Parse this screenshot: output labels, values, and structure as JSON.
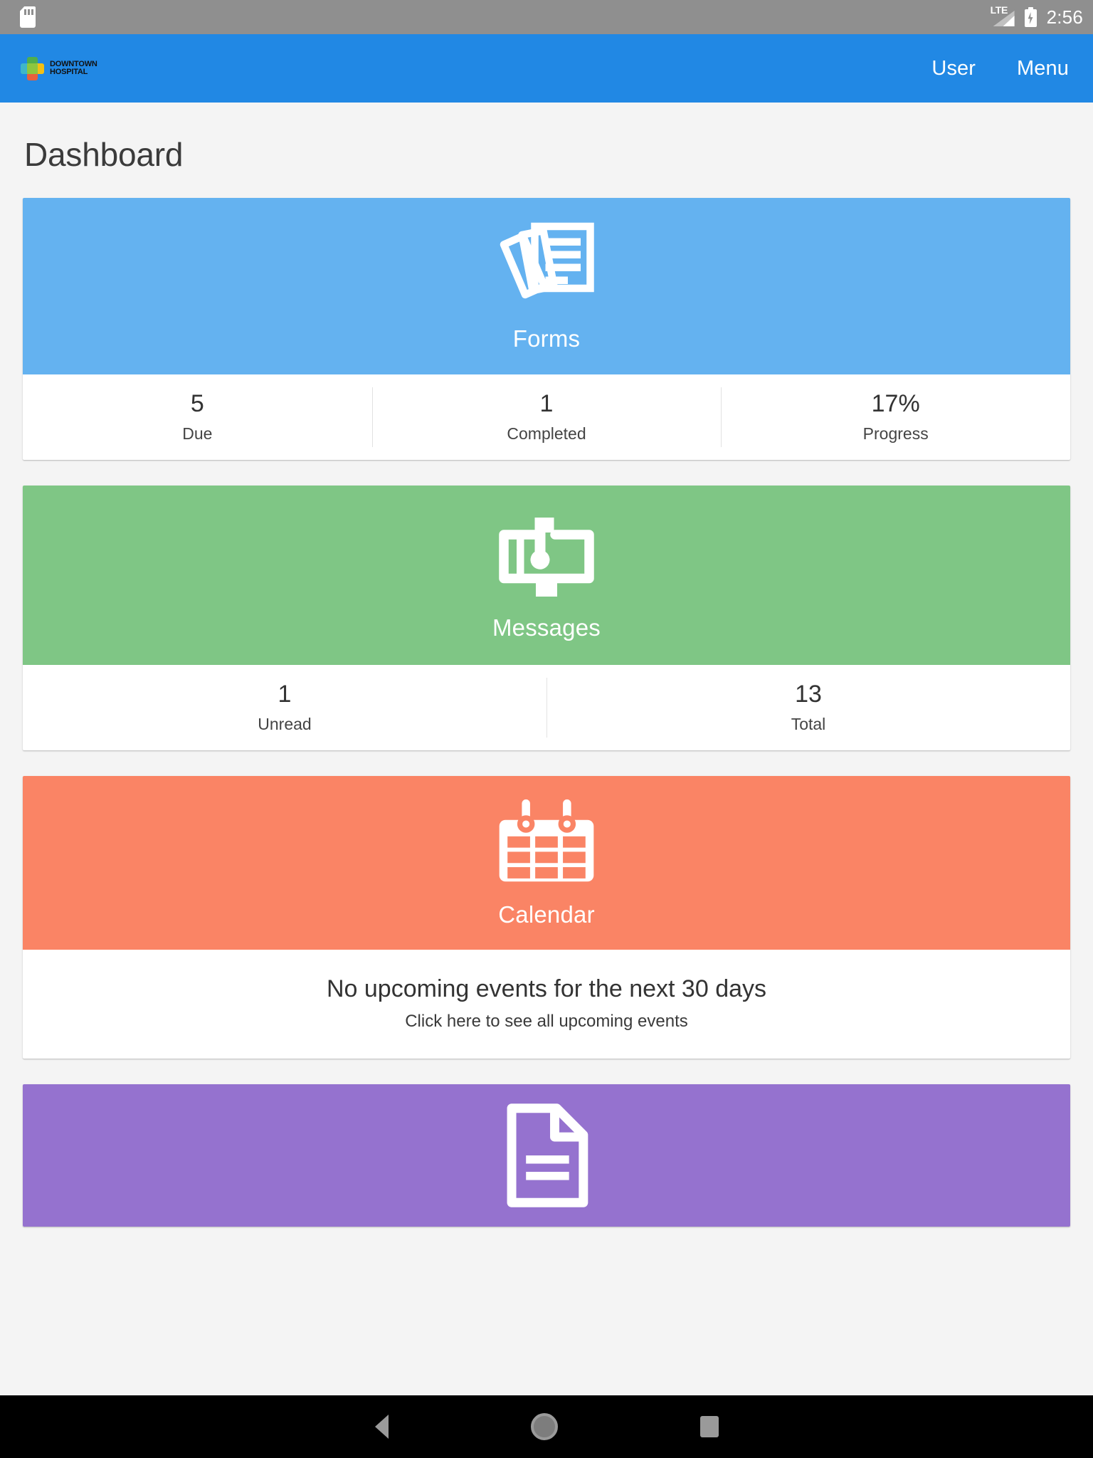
{
  "status_bar": {
    "sd_icon": "sd-card-icon",
    "network": "LTE",
    "battery_state": "charging",
    "time": "2:56"
  },
  "app_bar": {
    "logo_line1": "DOWNTOWN",
    "logo_line2": "HOSPITAL",
    "logo_icon": "pinwheel-cross-logo",
    "nav": [
      {
        "label": "User",
        "name": "user"
      },
      {
        "label": "Menu",
        "name": "menu"
      }
    ]
  },
  "page": {
    "title": "Dashboard"
  },
  "cards": {
    "forms": {
      "label": "Forms",
      "icon": "documents-stack-icon",
      "color": "#64b2f0",
      "stats": [
        {
          "value": "5",
          "label": "Due"
        },
        {
          "value": "1",
          "label": "Completed"
        },
        {
          "value": "17%",
          "label": "Progress"
        }
      ]
    },
    "messages": {
      "label": "Messages",
      "icon": "mailbox-icon",
      "color": "#7fc685",
      "stats": [
        {
          "value": "1",
          "label": "Unread"
        },
        {
          "value": "13",
          "label": "Total"
        }
      ]
    },
    "calendar": {
      "label": "Calendar",
      "icon": "calendar-icon",
      "color": "#fa8465",
      "headline": "No upcoming events for the next 30 days",
      "sub": "Click here to see all upcoming events"
    },
    "document": {
      "icon": "document-page-icon",
      "color": "#9572cf"
    }
  },
  "nav_bar": {
    "back": "back-icon",
    "home": "home-icon",
    "recents": "recents-icon"
  }
}
